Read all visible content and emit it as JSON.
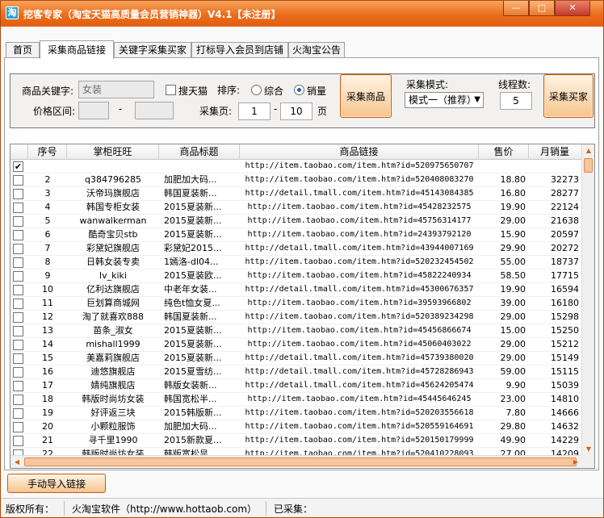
{
  "window": {
    "app_icon": "淘",
    "title": "挖客专家（淘宝天猫高质量会员营销神器）V4.1【未注册】",
    "min_glyph": "—",
    "max_glyph": "□",
    "close_glyph": "✕"
  },
  "tabs": [
    "首页",
    "采集商品链接",
    "关键字采集买家",
    "打标导入会员到店铺",
    "火淘宝公告"
  ],
  "filter": {
    "keyword_label": "商品关键字:",
    "keyword_value": "女装",
    "tmall_label": "搜天猫",
    "sort_label": "排序:",
    "sort_composite": "综合",
    "sort_sales": "销量",
    "price_label": "价格区间:",
    "dash": "-",
    "page_label": "采集页:",
    "page_from": "1",
    "page_to": "10",
    "page_unit": "页",
    "collect_goods_button": "采集商品",
    "mode_label": "采集模式:",
    "mode_value": "模式一（推荐）",
    "threads_label": "线程数:",
    "threads_value": "5",
    "collect_buyers_button": "采集买家"
  },
  "grid": {
    "columns": [
      "",
      "序号",
      "掌柜旺旺",
      "商品标题",
      "商品链接",
      "售价",
      "月销量"
    ],
    "rows": [
      {
        "checked": true,
        "no": "",
        "seller": "",
        "title": "",
        "link": "http://item.taobao.com/item.htm?id=520975650707",
        "price": "",
        "sales": ""
      },
      {
        "checked": false,
        "no": "2",
        "seller": "q384796285",
        "title": "加肥加大码...",
        "link": "http://item.taobao.com/item.htm?id=520408083270",
        "price": "18.80",
        "sales": "32273"
      },
      {
        "checked": false,
        "no": "3",
        "seller": "沃帝玛旗舰店",
        "title": "韩国夏装新...",
        "link": "http://detail.tmall.com/item.htm?id=45143084385",
        "price": "16.80",
        "sales": "28277"
      },
      {
        "checked": false,
        "no": "4",
        "seller": "韩国专柜女装",
        "title": "2015夏装新...",
        "link": "http://item.taobao.com/item.htm?id=45428232575",
        "price": "19.90",
        "sales": "22124"
      },
      {
        "checked": false,
        "no": "5",
        "seller": "wanwalkerman",
        "title": "2015夏装新...",
        "link": "http://item.taobao.com/item.htm?id=45756314177",
        "price": "29.00",
        "sales": "21638"
      },
      {
        "checked": false,
        "no": "6",
        "seller": "酷奇宝贝stb",
        "title": "2015夏装新...",
        "link": "http://item.taobao.com/item.htm?id=24393792120",
        "price": "15.90",
        "sales": "20597"
      },
      {
        "checked": false,
        "no": "7",
        "seller": "彩黛妃旗舰店",
        "title": "彩黛妃2015...",
        "link": "http://detail.tmall.com/item.htm?id=43944007169",
        "price": "29.90",
        "sales": "20272"
      },
      {
        "checked": false,
        "no": "8",
        "seller": "日韩女装专卖",
        "title": "1嫣洛-dl04...",
        "link": "http://item.taobao.com/item.htm?id=520232454502",
        "price": "55.00",
        "sales": "18737"
      },
      {
        "checked": false,
        "no": "9",
        "seller": "lv_kiki",
        "title": "2015夏装欧...",
        "link": "http://item.taobao.com/item.htm?id=45822240934",
        "price": "58.50",
        "sales": "17715"
      },
      {
        "checked": false,
        "no": "10",
        "seller": "亿利达旗舰店",
        "title": "中老年女装...",
        "link": "http://detail.tmall.com/item.htm?id=45300676357",
        "price": "19.90",
        "sales": "16594"
      },
      {
        "checked": false,
        "no": "11",
        "seller": "巨划算商城网",
        "title": "纯色t恤女夏...",
        "link": "http://item.taobao.com/item.htm?id=39593966802",
        "price": "39.00",
        "sales": "16180"
      },
      {
        "checked": false,
        "no": "12",
        "seller": "淘了就喜欢888",
        "title": "韩国夏装新...",
        "link": "http://item.taobao.com/item.htm?id=520389234298",
        "price": "29.00",
        "sales": "15298"
      },
      {
        "checked": false,
        "no": "13",
        "seller": "苗条_淑女",
        "title": "2015夏装新...",
        "link": "http://item.taobao.com/item.htm?id=45456866674",
        "price": "15.00",
        "sales": "15250"
      },
      {
        "checked": false,
        "no": "14",
        "seller": "mishall1999",
        "title": "2015夏装新...",
        "link": "http://item.taobao.com/item.htm?id=45060403022",
        "price": "29.00",
        "sales": "15212"
      },
      {
        "checked": false,
        "no": "15",
        "seller": "美嘉莉旗舰店",
        "title": "2015夏装新...",
        "link": "http://detail.tmall.com/item.htm?id=45739380020",
        "price": "29.00",
        "sales": "15149"
      },
      {
        "checked": false,
        "no": "16",
        "seller": "迪悠旗舰店",
        "title": "2015夏雪纺...",
        "link": "http://detail.tmall.com/item.htm?id=45728286943",
        "price": "59.00",
        "sales": "15115"
      },
      {
        "checked": false,
        "no": "17",
        "seller": "婧纯旗舰店",
        "title": "韩版女装新...",
        "link": "http://detail.tmall.com/item.htm?id=45624205474",
        "price": "9.90",
        "sales": "15039"
      },
      {
        "checked": false,
        "no": "18",
        "seller": "韩版时尚坊女装",
        "title": "韩国宽松半...",
        "link": "http://item.taobao.com/item.htm?id=45445646245",
        "price": "23.00",
        "sales": "14810"
      },
      {
        "checked": false,
        "no": "19",
        "seller": "好评返三块",
        "title": "2015韩版新...",
        "link": "http://item.taobao.com/item.htm?id=520203556618",
        "price": "7.80",
        "sales": "14666"
      },
      {
        "checked": false,
        "no": "20",
        "seller": "小颗粒服饰",
        "title": "加肥加大码...",
        "link": "http://item.taobao.com/item.htm?id=520559164691",
        "price": "29.80",
        "sales": "14632"
      },
      {
        "checked": false,
        "no": "21",
        "seller": "寻千里1990",
        "title": "2015新款夏...",
        "link": "http://item.taobao.com/item.htm?id=520150179999",
        "price": "49.90",
        "sales": "14229"
      },
      {
        "checked": false,
        "no": "22",
        "seller": "韩版时尚坊女装",
        "title": "韩版宽松显...",
        "link": "http://item.taobao.com/item.htm?id=520410228093",
        "price": "27.00",
        "sales": "14209"
      }
    ]
  },
  "manual_import_button": "手动导入链接",
  "status": {
    "copyright": "版权所有：",
    "company": "火淘宝软件（http://www.hottaob.com）",
    "collected": "已采集："
  },
  "colors": {
    "title_bar": "#ea6d1c",
    "button_border": "#c65a12",
    "scroll_thumb": "#f7c59b"
  },
  "icons": [
    "app-logo-icon",
    "minimize-icon",
    "maximize-icon",
    "close-icon",
    "checkbox-icon",
    "radio-icon",
    "chevron-down-icon",
    "scroll-arrow-icon"
  ]
}
